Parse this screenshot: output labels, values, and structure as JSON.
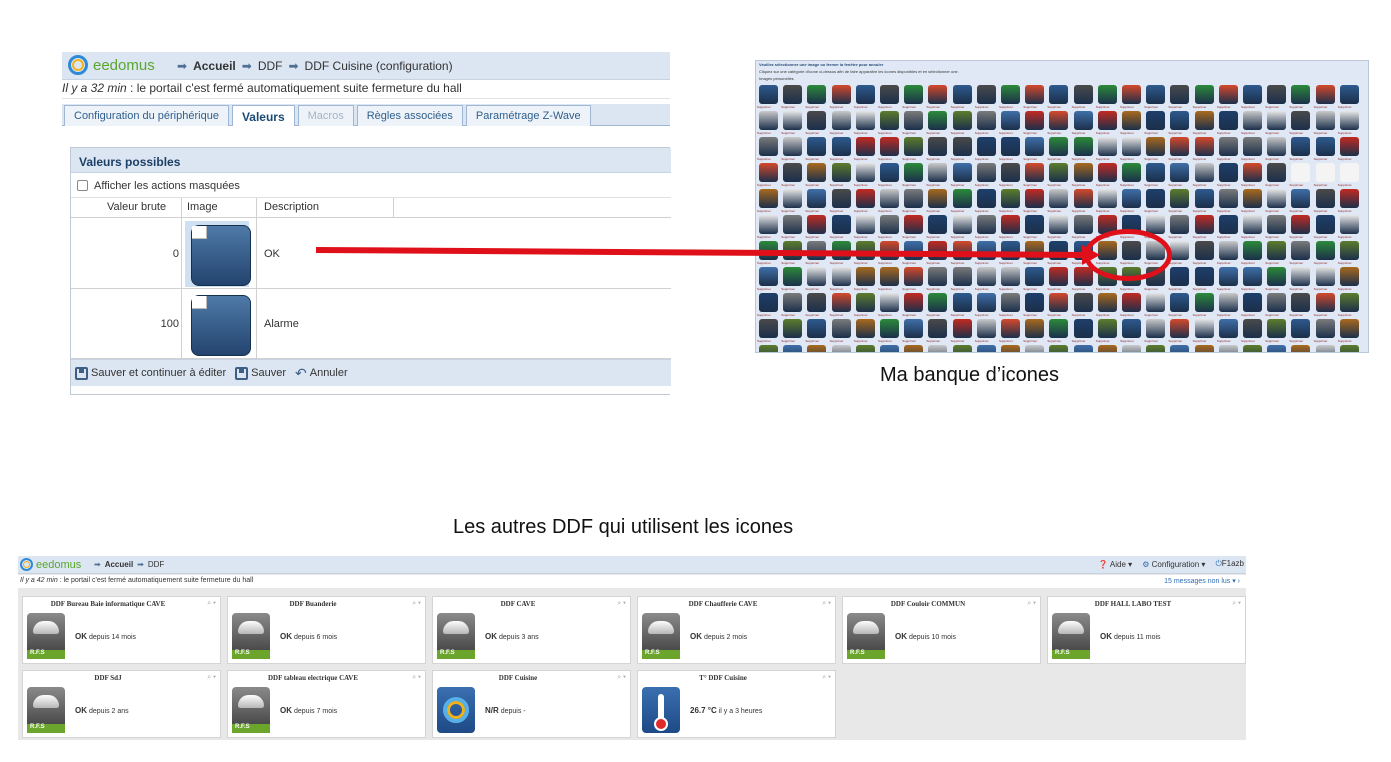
{
  "config_panel": {
    "logo": "eedomus",
    "breadcrumb": [
      "Accueil",
      "DDF",
      "DDF Cuisine (configuration)"
    ],
    "status_time": "Il y a 32 min",
    "status_text": " : le portail c'est fermé automatiquement suite fermeture du hall",
    "tabs": [
      {
        "label": "Configuration du périphérique",
        "state": "normal"
      },
      {
        "label": "Valeurs",
        "state": "active"
      },
      {
        "label": "Macros",
        "state": "disabled"
      },
      {
        "label": "Règles associées",
        "state": "normal"
      },
      {
        "label": "Paramétrage Z-Wave",
        "state": "normal"
      }
    ],
    "section_title": "Valeurs possibles",
    "show_hidden_label": "Afficher les actions masquées",
    "columns": [
      "Valeur brute",
      "Image",
      "Description"
    ],
    "rows": [
      {
        "raw": "0",
        "description": "OK"
      },
      {
        "raw": "100",
        "description": "Alarme"
      }
    ],
    "footer": {
      "save_continue": "Sauver et continuer à éditer",
      "save": "Sauver",
      "cancel": "Annuler"
    }
  },
  "icon_bank": {
    "header": "Veuillez sélectionner une image ou fermer la fenêtre pour annuler",
    "instructions": "Cliquez sur une catégorie d'icone ci-dessus afin de faire apparaitre les icones disponibles et en sélectionner une.",
    "personal_label": "Images personelles",
    "delete_label": "Supprimer",
    "caption": "Ma banque d’icones"
  },
  "mid_title": "Les autres DDF qui utilisent les icones",
  "dashboard": {
    "logo": "eedomus",
    "breadcrumb": [
      "Accueil",
      "DDF"
    ],
    "help": "Aide",
    "config": "Configuration",
    "user": "F1azb",
    "status_time": "Il y a 42 min",
    "status_text": " : le portail c'est fermé automatiquement suite fermeture du hall",
    "messages": "15 messages non lus",
    "badge": "R.F.S",
    "cards": [
      {
        "title": "DDF Bureau Baie informatique CAVE",
        "value": "OK",
        "since": "depuis 14 mois",
        "icon": "smoke-detector"
      },
      {
        "title": "DDF Buanderie",
        "value": "OK",
        "since": "depuis 6 mois",
        "icon": "smoke-detector"
      },
      {
        "title": "DDF CAVE",
        "value": "OK",
        "since": "depuis 3 ans",
        "icon": "smoke-detector"
      },
      {
        "title": "DDF Chaufferie CAVE",
        "value": "OK",
        "since": "depuis 2 mois",
        "icon": "smoke-detector"
      },
      {
        "title": "DDF Couloir COMMUN",
        "value": "OK",
        "since": "depuis 10 mois",
        "icon": "smoke-detector"
      },
      {
        "title": "DDF HALL LABO TEST",
        "value": "OK",
        "since": "depuis 11 mois",
        "icon": "smoke-detector"
      },
      {
        "title": "DDF SdJ",
        "value": "OK",
        "since": "depuis 2 ans",
        "icon": "smoke-detector"
      },
      {
        "title": "DDF tableau electrique CAVE",
        "value": "OK",
        "since": "depuis 7 mois",
        "icon": "smoke-detector"
      },
      {
        "title": "DDF Cuisine",
        "value": "N/R",
        "since": "depuis -",
        "icon": "eedomus-logo"
      },
      {
        "title": "T° DDF Cuisine",
        "value": "26.7 °C",
        "since": "il y a 3 heures",
        "icon": "thermometer"
      }
    ]
  },
  "colors": {
    "accent_red": "#e0101a",
    "header_blue": "#dce6f2",
    "brand_green": "#5aa62e"
  }
}
